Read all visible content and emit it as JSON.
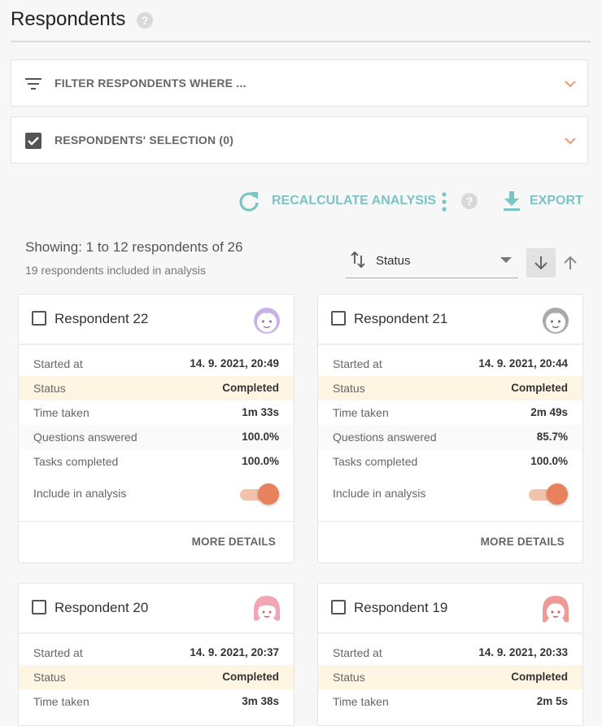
{
  "header": {
    "title": "Respondents",
    "help": "?"
  },
  "filter_panel": {
    "label": "FILTER RESPONDENTS WHERE ..."
  },
  "selection_panel": {
    "label": "RESPONDENTS' SELECTION (0)"
  },
  "toolbar": {
    "recalculate_label": "RECALCULATE ANALYSIS",
    "help": "?",
    "export_label": "EXPORT"
  },
  "summary": {
    "showing": "Showing: 1 to 12 respondents of 26",
    "included": "19 respondents included in analysis"
  },
  "sort": {
    "selected": "Status"
  },
  "field_labels": {
    "started": "Started at",
    "status": "Status",
    "time": "Time taken",
    "questions": "Questions answered",
    "tasks": "Tasks completed",
    "include": "Include in analysis",
    "more": "MORE DETAILS"
  },
  "respondents": [
    {
      "name": "Respondent 22",
      "started": "14. 9. 2021, 20:49",
      "status": "Completed",
      "time": "1m 33s",
      "questions": "100.0%",
      "tasks": "100.0%",
      "avatar": "boy-avatar-purple",
      "avatar_color": "#c9b3e6",
      "included": true
    },
    {
      "name": "Respondent 21",
      "started": "14. 9. 2021, 20:44",
      "status": "Completed",
      "time": "2m 49s",
      "questions": "85.7%",
      "tasks": "100.0%",
      "avatar": "boy-avatar-gray",
      "avatar_color": "#a9a9a9",
      "included": true
    },
    {
      "name": "Respondent 20",
      "started": "14. 9. 2021, 20:37",
      "status": "Completed",
      "time": "3m 38s",
      "avatar": "girl-avatar-pink",
      "avatar_color": "#f0a6b4"
    },
    {
      "name": "Respondent 19",
      "started": "14. 9. 2021, 20:33",
      "status": "Completed",
      "time": "2m 5s",
      "avatar": "girl-avatar-salmon",
      "avatar_color": "#ee9a95"
    }
  ],
  "colors": {
    "accent": "#7bc4c4",
    "toggle": "#e8825c",
    "chevron": "#e8a07c",
    "status_bg": "#fff5e3"
  }
}
